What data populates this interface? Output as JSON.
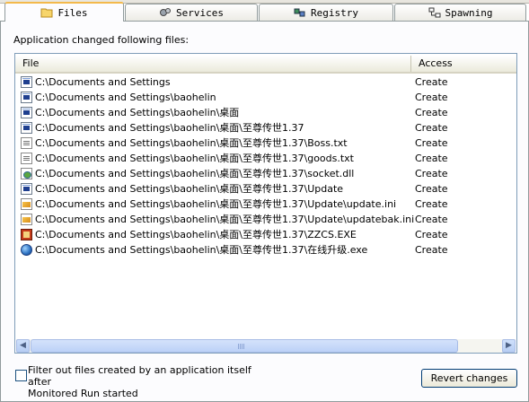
{
  "tabs": [
    {
      "label": "Files",
      "icon": "folder-icon",
      "active": true
    },
    {
      "label": "Services",
      "icon": "services-icon",
      "active": false
    },
    {
      "label": "Registry",
      "icon": "registry-icon",
      "active": false
    },
    {
      "label": "Spawning",
      "icon": "spawning-icon",
      "active": false
    }
  ],
  "caption": "Application changed following files:",
  "table": {
    "columns": [
      "File",
      "Access"
    ],
    "rows": [
      {
        "path": "C:\\Documents and Settings",
        "access": "Create",
        "icon": "folder-icon"
      },
      {
        "path": "C:\\Documents and Settings\\baohelin",
        "access": "Create",
        "icon": "folder-icon"
      },
      {
        "path": "C:\\Documents and Settings\\baohelin\\桌面",
        "access": "Create",
        "icon": "folder-icon"
      },
      {
        "path": "C:\\Documents and Settings\\baohelin\\桌面\\至尊传世1.37",
        "access": "Create",
        "icon": "folder-icon"
      },
      {
        "path": "C:\\Documents and Settings\\baohelin\\桌面\\至尊传世1.37\\Boss.txt",
        "access": "Create",
        "icon": "text-file-icon"
      },
      {
        "path": "C:\\Documents and Settings\\baohelin\\桌面\\至尊传世1.37\\goods.txt",
        "access": "Create",
        "icon": "text-file-icon"
      },
      {
        "path": "C:\\Documents and Settings\\baohelin\\桌面\\至尊传世1.37\\socket.dll",
        "access": "Create",
        "icon": "dll-file-icon"
      },
      {
        "path": "C:\\Documents and Settings\\baohelin\\桌面\\至尊传世1.37\\Update",
        "access": "Create",
        "icon": "folder-icon"
      },
      {
        "path": "C:\\Documents and Settings\\baohelin\\桌面\\至尊传世1.37\\Update\\update.ini",
        "access": "Create",
        "icon": "ini-file-icon"
      },
      {
        "path": "C:\\Documents and Settings\\baohelin\\桌面\\至尊传世1.37\\Update\\updatebak.ini",
        "access": "Create",
        "icon": "ini-file-icon"
      },
      {
        "path": "C:\\Documents and Settings\\baohelin\\桌面\\至尊传世1.37\\ZZCS.EXE",
        "access": "Create",
        "icon": "exe-file-icon"
      },
      {
        "path": "C:\\Documents and Settings\\baohelin\\桌面\\至尊传世1.37\\在线升级.exe",
        "access": "Create",
        "icon": "globe-exe-icon"
      }
    ]
  },
  "filter_checkbox": {
    "label_line1": "Filter out files created by an application itself after",
    "label_line2": "Monitored Run started",
    "checked": false
  },
  "revert_button": "Revert changes"
}
